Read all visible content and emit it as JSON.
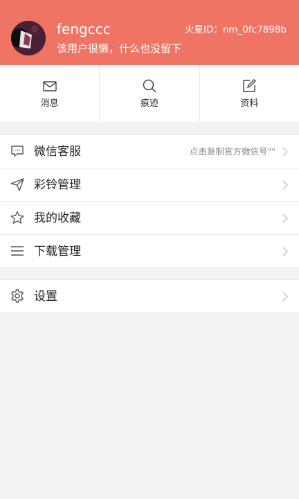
{
  "profile": {
    "username": "fengccc",
    "signature": "该用户很懒，什么也没留下",
    "id_text": "火星ID：nm_0fc7898b",
    "avatar_icon": "user-avatar"
  },
  "quick_actions": [
    {
      "label": "消息",
      "icon": "mail-icon"
    },
    {
      "label": "痕迹",
      "icon": "search-icon"
    },
    {
      "label": "资料",
      "icon": "edit-icon"
    }
  ],
  "menu": [
    {
      "label": "微信客服",
      "hint": "点击复制官方微信号\"\"",
      "icon": "chat-icon"
    },
    {
      "label": "彩铃管理",
      "icon": "send-icon"
    },
    {
      "label": "我的收藏",
      "icon": "star-icon"
    },
    {
      "label": "下载管理",
      "icon": "list-icon"
    }
  ],
  "settings": {
    "label": "设置",
    "icon": "gear-icon"
  },
  "colors": {
    "header_bg": "#f07463",
    "page_bg": "#f1f3f4"
  }
}
